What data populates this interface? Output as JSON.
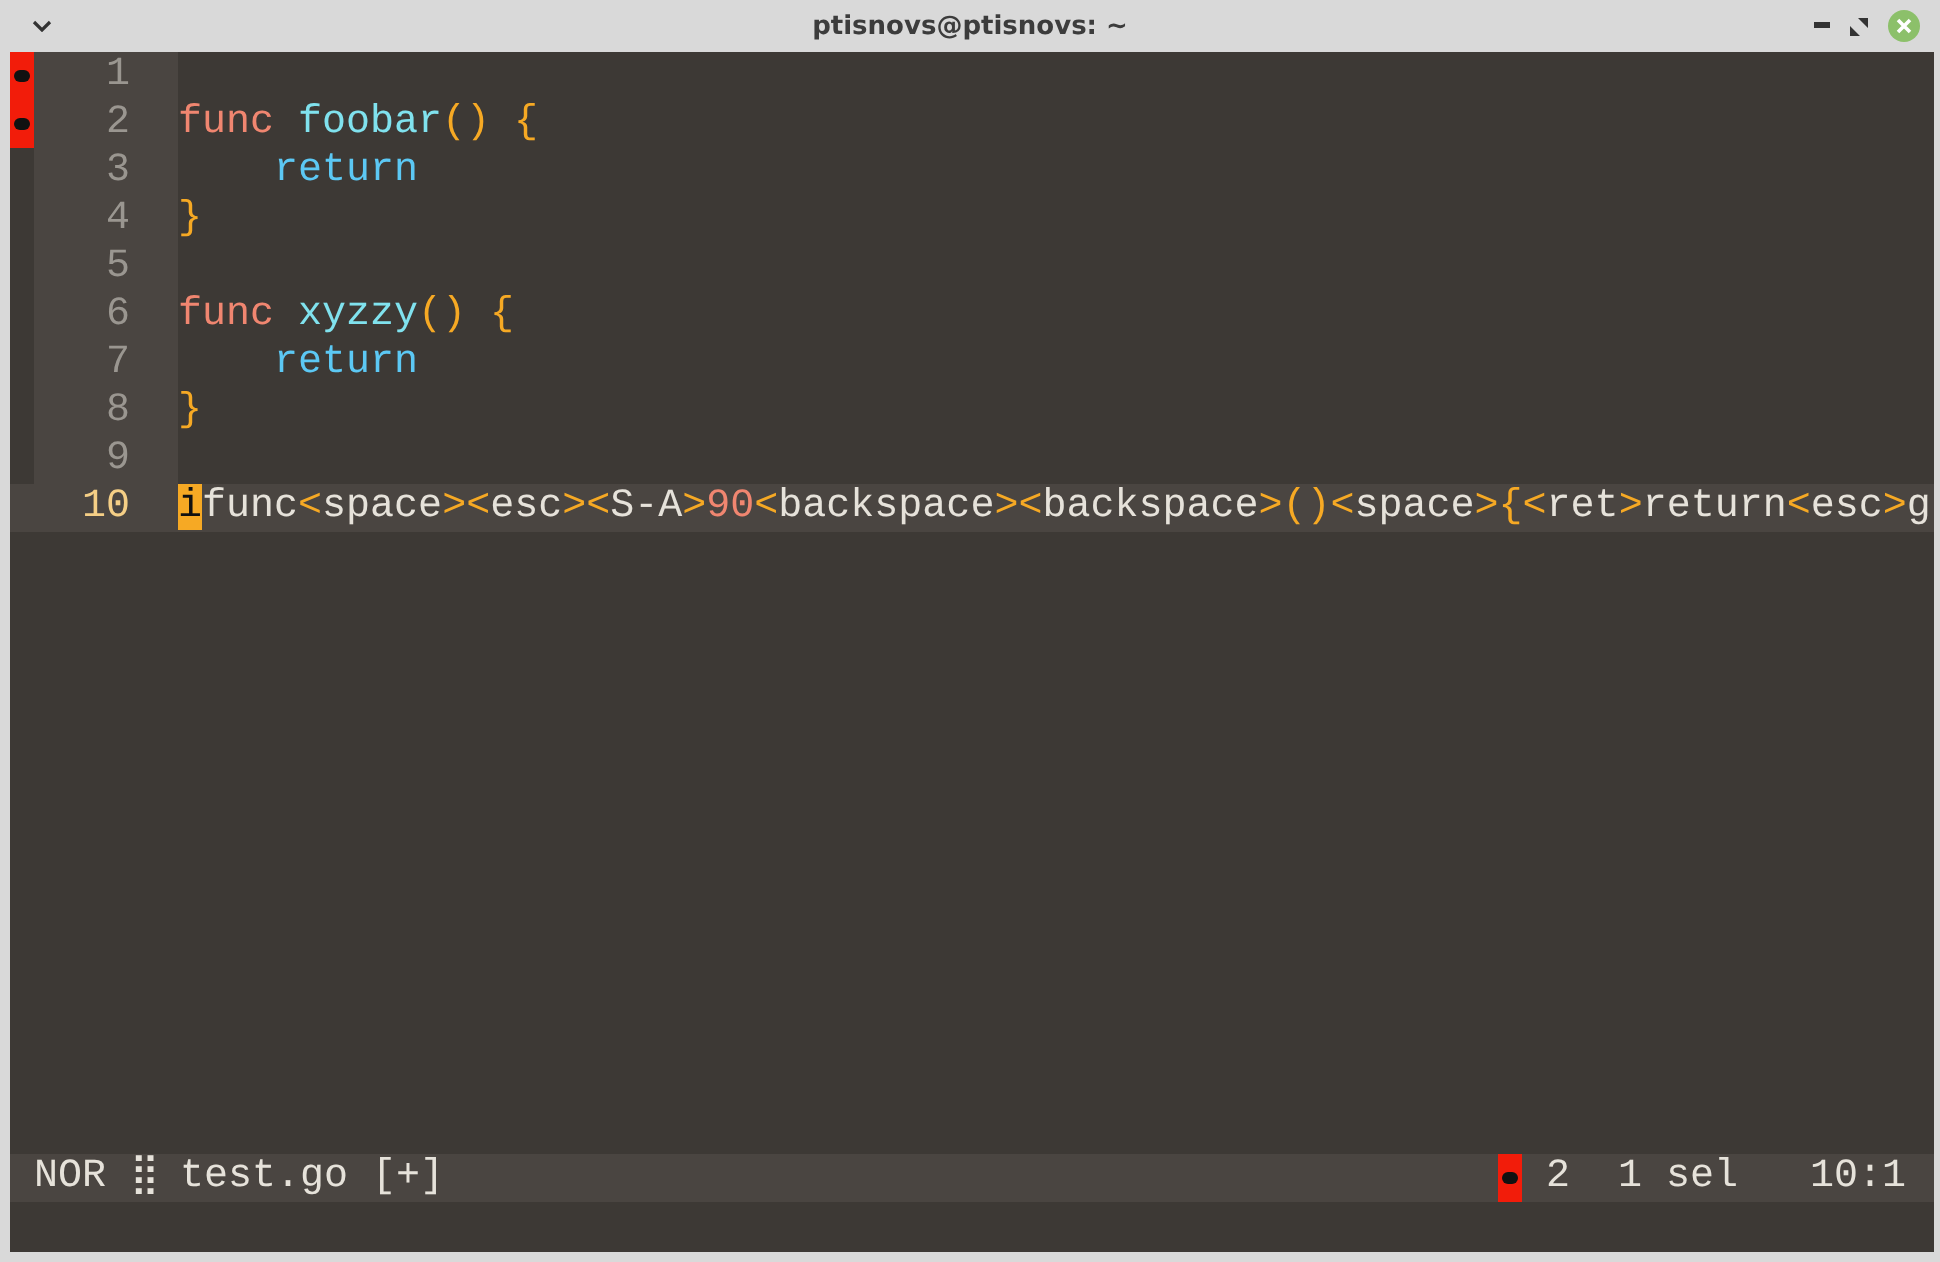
{
  "window": {
    "title": "ptisnovs@ptisnovs: ~"
  },
  "editor": {
    "lines": [
      {
        "number": "1",
        "marker": true,
        "current": false
      },
      {
        "number": "2",
        "marker": true,
        "current": false,
        "indented": false,
        "tokens": [
          {
            "kind": "keyword",
            "text": "func "
          },
          {
            "kind": "function",
            "text": "foobar"
          },
          {
            "kind": "punct",
            "text": "() {"
          }
        ]
      },
      {
        "number": "3",
        "marker": false,
        "current": false,
        "indented": true,
        "tokens": [
          {
            "kind": "return",
            "text": "return"
          }
        ]
      },
      {
        "number": "4",
        "marker": false,
        "current": false,
        "indented": false,
        "tokens": [
          {
            "kind": "punct",
            "text": "}"
          }
        ]
      },
      {
        "number": "5",
        "marker": false,
        "current": false
      },
      {
        "number": "6",
        "marker": false,
        "current": false,
        "indented": false,
        "tokens": [
          {
            "kind": "keyword",
            "text": "func "
          },
          {
            "kind": "function",
            "text": "xyzzy"
          },
          {
            "kind": "punct",
            "text": "() {"
          }
        ]
      },
      {
        "number": "7",
        "marker": false,
        "current": false,
        "indented": true,
        "tokens": [
          {
            "kind": "return",
            "text": "return"
          }
        ]
      },
      {
        "number": "8",
        "marker": false,
        "current": false,
        "indented": false,
        "tokens": [
          {
            "kind": "punct",
            "text": "}"
          }
        ]
      },
      {
        "number": "9",
        "marker": false,
        "current": false
      },
      {
        "number": "10",
        "marker": false,
        "current": true,
        "indented": false,
        "tokens": [
          {
            "kind": "cursor",
            "text": "i"
          },
          {
            "kind": "plain",
            "text": "func"
          },
          {
            "kind": "punct",
            "text": "<"
          },
          {
            "kind": "plain",
            "text": "space"
          },
          {
            "kind": "punct",
            "text": "><"
          },
          {
            "kind": "plain",
            "text": "esc"
          },
          {
            "kind": "punct",
            "text": "><"
          },
          {
            "kind": "plain",
            "text": "S-A"
          },
          {
            "kind": "punct",
            "text": ">"
          },
          {
            "kind": "number",
            "text": "90"
          },
          {
            "kind": "punct",
            "text": "<"
          },
          {
            "kind": "plain",
            "text": "backspace"
          },
          {
            "kind": "punct",
            "text": "><"
          },
          {
            "kind": "plain",
            "text": "backspace"
          },
          {
            "kind": "punct",
            "text": ">()<"
          },
          {
            "kind": "plain",
            "text": "space"
          },
          {
            "kind": "punct",
            "text": ">{<"
          },
          {
            "kind": "plain",
            "text": "ret"
          },
          {
            "kind": "punct",
            "text": ">"
          },
          {
            "kind": "plain",
            "text": "return"
          },
          {
            "kind": "punct",
            "text": "<"
          },
          {
            "kind": "plain",
            "text": "esc"
          },
          {
            "kind": "punct",
            "text": ">"
          },
          {
            "kind": "plain",
            "text": "g"
          }
        ]
      }
    ]
  },
  "status_bar": {
    "mode": "NOR",
    "separator": "⣿",
    "file": "test.go [+]",
    "marker": true,
    "selection_count": "2",
    "selections": "1 sel",
    "position": "10:1"
  }
}
